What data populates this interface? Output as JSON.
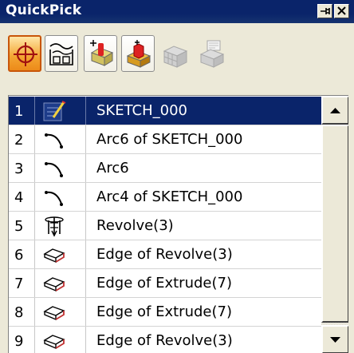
{
  "window": {
    "title": "QuickPick",
    "pin_icon": "pin-icon",
    "close_icon": "close-icon"
  },
  "toolbar": {
    "buttons": [
      {
        "icon": "crosshair-select-icon",
        "state": "active"
      },
      {
        "icon": "curve-sketch-icon",
        "state": "normal"
      },
      {
        "icon": "face-point-icon",
        "state": "normal"
      },
      {
        "icon": "solid-extrude-icon",
        "state": "normal"
      },
      {
        "icon": "cube-grid-icon",
        "state": "disabled"
      },
      {
        "icon": "plane-cube-icon",
        "state": "disabled"
      }
    ]
  },
  "list": {
    "items": [
      {
        "num": "1",
        "icon": "sketch-icon",
        "label": "SKETCH_000",
        "selected": true
      },
      {
        "num": "2",
        "icon": "arc-icon",
        "label": "Arc6 of SKETCH_000"
      },
      {
        "num": "3",
        "icon": "arc-icon",
        "label": "Arc6"
      },
      {
        "num": "4",
        "icon": "arc-icon",
        "label": "Arc4 of SKETCH_000"
      },
      {
        "num": "5",
        "icon": "revolve-icon",
        "label": "Revolve(3)"
      },
      {
        "num": "6",
        "icon": "edge-icon",
        "label": "Edge of Revolve(3)"
      },
      {
        "num": "7",
        "icon": "edge-icon",
        "label": "Edge of Extrude(7)"
      },
      {
        "num": "8",
        "icon": "edge-icon",
        "label": "Edge of Extrude(7)"
      },
      {
        "num": "9",
        "icon": "edge-icon",
        "label": "Edge of Revolve(3)"
      }
    ]
  },
  "colors": {
    "title_bar": "#0a246a",
    "selection": "#0a246a",
    "active_tool": "#f3a430"
  }
}
